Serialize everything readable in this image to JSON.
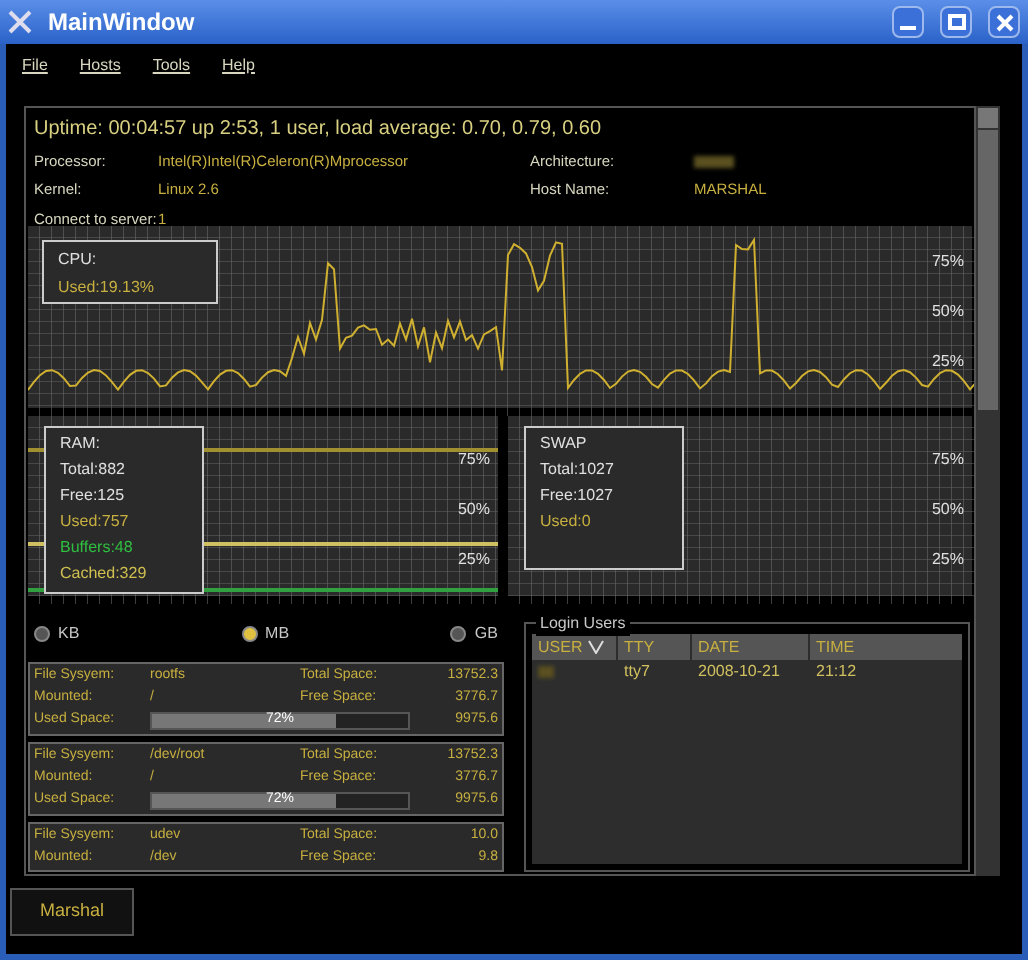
{
  "window": {
    "title": "MainWindow"
  },
  "menu": [
    "File",
    "Hosts",
    "Tools",
    "Help"
  ],
  "system": {
    "uptime": "Uptime: 00:04:57 up  2:53,  1 user,  load average: 0.70, 0.79, 0.60",
    "fields": [
      {
        "label": "Processor:",
        "value": "Intel(R)Intel(R)Celeron(R)Mprocessor"
      },
      {
        "label": "Architecture:"
      },
      {
        "label": "Kernel:",
        "value": "Linux 2.6"
      },
      {
        "label": "Host Name:",
        "value": "MARSHAL"
      },
      {
        "label": "Connect to server:",
        "value": "1"
      }
    ]
  },
  "cpu": {
    "title": "CPU:",
    "used": "Used:19.13%",
    "ticks": [
      "75%",
      "50%",
      "25%"
    ]
  },
  "ram": {
    "title": "RAM:",
    "lines": [
      {
        "text": "Total:882",
        "color": "#e0e0e0"
      },
      {
        "text": "Free:125",
        "color": "#e0e0e0"
      },
      {
        "text": "Used:757",
        "color": "#c8b040"
      },
      {
        "text": "Buffers:48",
        "color": "#30c040"
      },
      {
        "text": "Cached:329",
        "color": "#d0c050"
      }
    ],
    "ticks": [
      "75%",
      "50%",
      "25%"
    ]
  },
  "swap": {
    "title": "SWAP",
    "lines": [
      {
        "text": "Total:1027",
        "color": "#e0e0e0"
      },
      {
        "text": "Free:1027",
        "color": "#e0e0e0"
      },
      {
        "text": "Used:0",
        "color": "#c8b040"
      }
    ],
    "ticks": [
      "75%",
      "50%",
      "25%"
    ]
  },
  "units": [
    {
      "label": "KB",
      "selected": false
    },
    {
      "label": "MB",
      "selected": true
    },
    {
      "label": "GB",
      "selected": false
    }
  ],
  "disks": [
    {
      "rows": [
        {
          "label": "File Sysyem:",
          "value": "rootfs",
          "label_2": "Total Space:",
          "value_2": "13752.3"
        },
        {
          "label": "Mounted:",
          "value": "/",
          "label_2": "Free Space:",
          "value_2": "3776.7"
        }
      ],
      "used": {
        "label": "Used Space:",
        "bar_label": "72%",
        "level": 0.72,
        "value": "9975.6"
      }
    },
    {
      "rows": [
        {
          "label": "File Sysyem:",
          "value": "/dev/root",
          "label_2": "Total Space:",
          "value_2": "13752.3"
        },
        {
          "label": "Mounted:",
          "value": "/",
          "label_2": "Free Space:",
          "value_2": "3776.7"
        }
      ],
      "used": {
        "label": "Used Space:",
        "bar_label": "72%",
        "level": 0.72,
        "value": "9975.6"
      }
    },
    {
      "rows": [
        {
          "label": "File Sysyem:",
          "value": "udev",
          "label_2": "Total Space:",
          "value_2": "10.0"
        },
        {
          "label": "Mounted:",
          "value": "/dev",
          "label_2": "Free Space:",
          "value_2": "9.8"
        }
      ]
    }
  ],
  "login_users": {
    "title": "Login Users",
    "columns": [
      {
        "label": "USER",
        "sorted": true
      },
      {
        "label": "TTY",
        "sorted": false
      },
      {
        "label": "DATE",
        "sorted": false
      },
      {
        "label": "TIME",
        "sorted": false
      }
    ],
    "rows": [
      {
        "tty": "tty7",
        "date": "2008-10-21",
        "time": "21:12"
      }
    ]
  },
  "tabs": [
    {
      "label": "Marshal",
      "selected": true
    }
  ]
}
